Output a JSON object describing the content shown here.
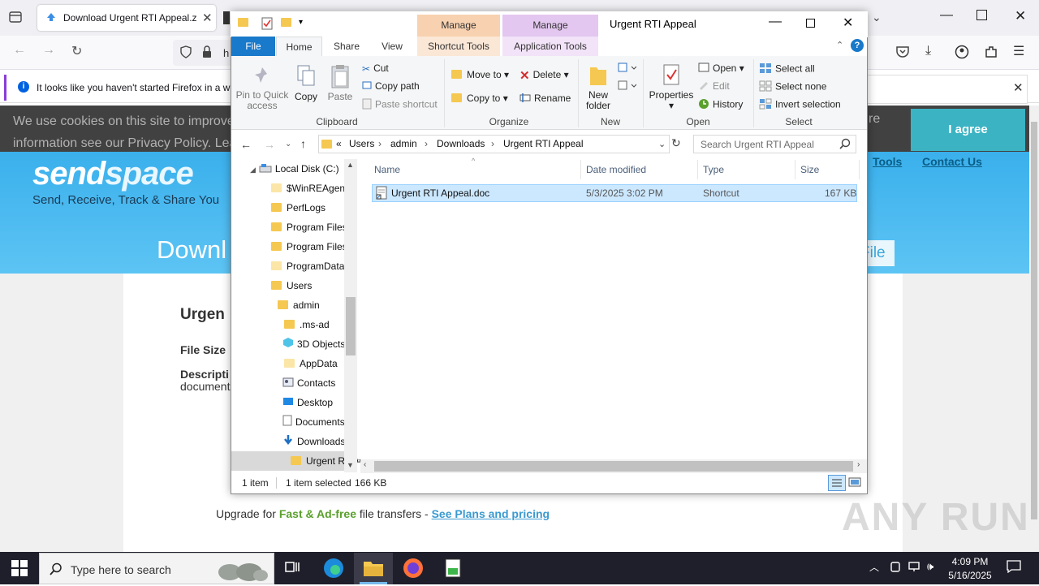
{
  "browser": {
    "tab_title": "Download Urgent RTI Appeal.zip",
    "url_partial": "h",
    "notification": "It looks like you haven't started Firefox in a while"
  },
  "website": {
    "cookie_text_line1": "We use cookies on this site to improve",
    "cookie_text_line2": "information see our Privacy Policy. Lea",
    "cookie_right": "re",
    "agree_button": "I agree",
    "logo_send": "send",
    "logo_space": "space",
    "tagline": "Send, Receive, Track & Share You",
    "nav_tools": "Tools",
    "nav_contact": "Contact Us",
    "download_heading": "Downl",
    "file_button": "File",
    "file_name_partial": "Urgen",
    "file_size_label": "File Size",
    "description_label": "Descripti",
    "description_value": "document",
    "upgrade_prefix": "Upgrade for ",
    "upgrade_highlight": "Fast & Ad-free",
    "upgrade_mid": " file transfers - ",
    "upgrade_link": "See Plans and pricing",
    "watermark": "ANY RUN"
  },
  "explorer": {
    "window_title": "Urgent RTI Appeal",
    "context_tab1": "Manage",
    "context_tab2": "Manage",
    "tabs": {
      "file": "File",
      "home": "Home",
      "share": "Share",
      "view": "View",
      "shortcut_tools": "Shortcut Tools",
      "application_tools": "Application Tools"
    },
    "ribbon": {
      "pin": "Pin to Quick access",
      "copy": "Copy",
      "paste": "Paste",
      "cut": "Cut",
      "copy_path": "Copy path",
      "paste_shortcut": "Paste shortcut",
      "clipboard": "Clipboard",
      "move_to": "Move to",
      "copy_to": "Copy to",
      "delete": "Delete",
      "rename": "Rename",
      "organize": "Organize",
      "new_folder": "New folder",
      "new": "New",
      "properties": "Properties",
      "open": "Open",
      "edit": "Edit",
      "history": "History",
      "open_group": "Open",
      "select_all": "Select all",
      "select_none": "Select none",
      "invert_selection": "Invert selection",
      "select_group": "Select"
    },
    "breadcrumb": [
      "«",
      "Users",
      "admin",
      "Downloads",
      "Urgent RTI Appeal"
    ],
    "search_placeholder": "Search Urgent RTI Appeal",
    "tree": [
      {
        "label": "Local Disk (C:)"
      },
      {
        "label": "$WinREAgent"
      },
      {
        "label": "PerfLogs"
      },
      {
        "label": "Program Files"
      },
      {
        "label": "Program Files"
      },
      {
        "label": "ProgramData"
      },
      {
        "label": "Users"
      },
      {
        "label": "admin"
      },
      {
        "label": ".ms-ad"
      },
      {
        "label": "3D Objects"
      },
      {
        "label": "AppData"
      },
      {
        "label": "Contacts"
      },
      {
        "label": "Desktop"
      },
      {
        "label": "Documents"
      },
      {
        "label": "Downloads"
      },
      {
        "label": "Urgent RTI Appeal"
      }
    ],
    "columns": [
      "Name",
      "Date modified",
      "Type",
      "Size"
    ],
    "files": [
      {
        "name": "Urgent RTI Appeal.doc",
        "date": "5/3/2025 3:02 PM",
        "type": "Shortcut",
        "size": "167 KB"
      }
    ],
    "status": {
      "count": "1 item",
      "selected": "1 item selected",
      "size": "166 KB"
    }
  },
  "taskbar": {
    "search_placeholder": "Type here to search",
    "time": "4:09 PM",
    "date": "5/16/2025"
  }
}
